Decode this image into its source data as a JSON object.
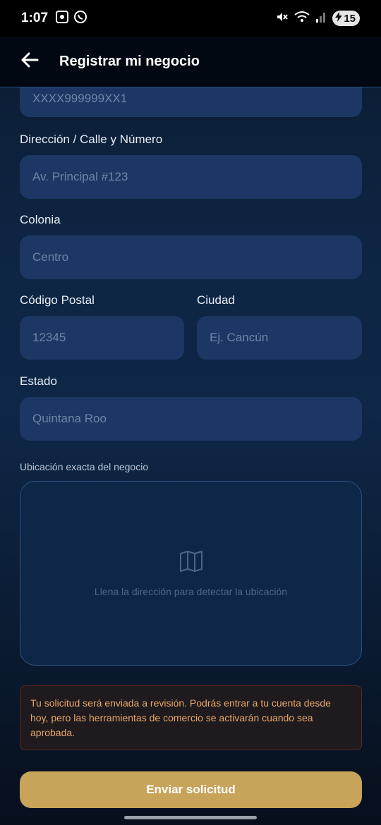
{
  "status_bar": {
    "time": "1:07",
    "battery": "15"
  },
  "app_bar": {
    "title": "Registrar mi negocio"
  },
  "form": {
    "rfc_placeholder": "XXXX999999XX1",
    "address_label": "Dirección / Calle y Número",
    "address_placeholder": "Av. Principal #123",
    "colonia_label": "Colonia",
    "colonia_placeholder": "Centro",
    "postal_label": "Código Postal",
    "postal_placeholder": "12345",
    "city_label": "Ciudad",
    "city_placeholder": "Ej. Cancún",
    "state_label": "Estado",
    "state_placeholder": "Quintana Roo",
    "location_label": "Ubicación exacta del negocio",
    "map_hint": "Llena la dirección para detectar la ubicación",
    "notice": "Tu solicitud será enviada a revisión. Podrás entrar a tu cuenta desde hoy, pero las herramientas de comercio se activarán cuando sea aprobada.",
    "submit_label": "Enviar solicitud"
  },
  "icons": {
    "back": "arrow-left-icon",
    "map": "map-icon"
  },
  "colors": {
    "accent": "#c8a35a",
    "field_bg": "#1c3763",
    "notice_text": "#e8a86a"
  }
}
